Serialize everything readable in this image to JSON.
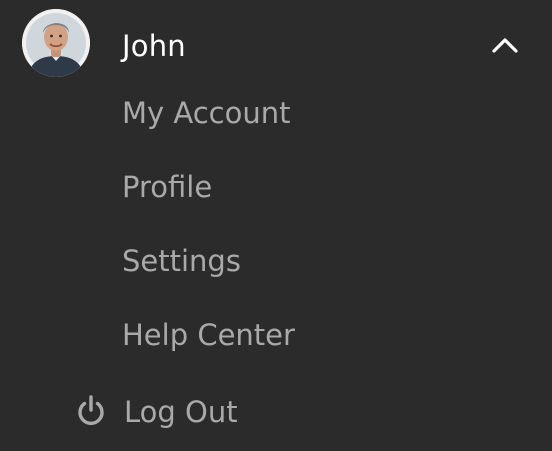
{
  "user": {
    "name": "John",
    "avatar_icon": "user-photo-avatar",
    "expanded": true
  },
  "menu": {
    "items": [
      {
        "label": "My Account"
      },
      {
        "label": "Profile"
      },
      {
        "label": "Settings"
      },
      {
        "label": "Help Center"
      }
    ],
    "logout": {
      "label": "Log Out",
      "icon": "power-icon"
    }
  },
  "colors": {
    "background": "#2b2b2b",
    "name_text": "#ffffff",
    "item_text": "#a9a9a9"
  }
}
